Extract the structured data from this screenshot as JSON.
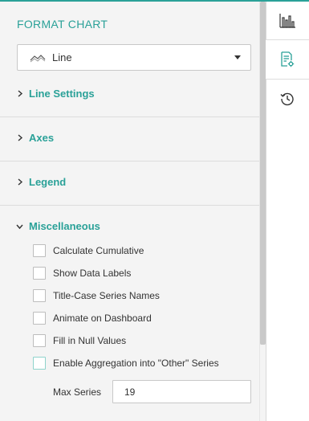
{
  "panel": {
    "title": "FORMAT CHART",
    "chart_type": {
      "value": "Line",
      "icon": "line-chart-icon"
    }
  },
  "sections": [
    {
      "label": "Line Settings",
      "expanded": false
    },
    {
      "label": "Axes",
      "expanded": false
    },
    {
      "label": "Legend",
      "expanded": false
    },
    {
      "label": "Miscellaneous",
      "expanded": true
    }
  ],
  "misc": {
    "options": [
      {
        "label": "Calculate Cumulative",
        "checked": false
      },
      {
        "label": "Show Data Labels",
        "checked": false
      },
      {
        "label": "Title-Case Series Names",
        "checked": false
      },
      {
        "label": "Animate on Dashboard",
        "checked": false
      },
      {
        "label": "Fill in Null Values",
        "checked": false
      },
      {
        "label": "Enable Aggregation into \"Other\" Series",
        "checked": false
      }
    ],
    "max_series": {
      "label": "Max Series",
      "value": "19"
    }
  },
  "rail": {
    "items": [
      {
        "icon": "bar-chart-icon"
      },
      {
        "icon": "format-settings-icon",
        "active": true
      },
      {
        "icon": "history-icon"
      }
    ]
  },
  "colors": {
    "accent": "#2aa198",
    "panel_bg": "#f4f4f4"
  }
}
